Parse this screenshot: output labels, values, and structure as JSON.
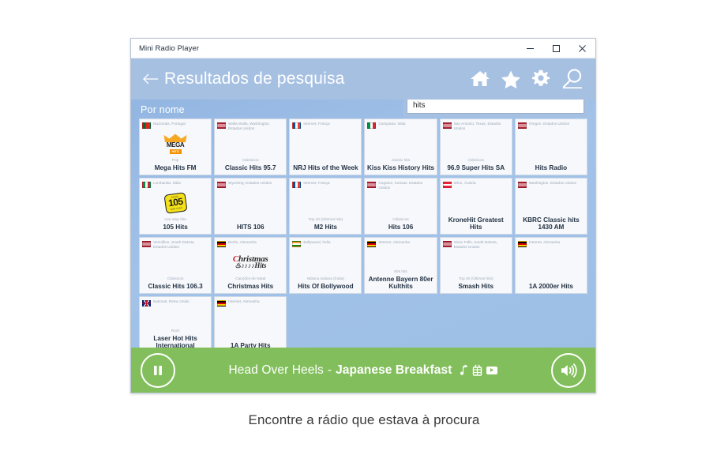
{
  "window": {
    "title": "Mini Radio Player",
    "controls": {
      "minimize": "minimize-icon",
      "maximize": "maximize-icon",
      "close": "close-icon"
    }
  },
  "header": {
    "back": "back-arrow-icon",
    "title": "Resultados de pesquisa",
    "icons": [
      "home-icon",
      "star-icon",
      "gear-icon",
      "search-icon"
    ]
  },
  "search": {
    "value": "hits",
    "placeholder": ""
  },
  "section": {
    "label": "Por nome"
  },
  "colors": {
    "header_blue": "#a6c0e2",
    "body_blue": "#9dbfe6",
    "player_green": "#82bf5c",
    "card_bg": "#f6f8fb",
    "card_border": "#cfd9e6"
  },
  "stations": [
    {
      "flag": "pt",
      "location": "Nacionais, Portugal",
      "genre": "Pop",
      "name": "Mega Hits FM",
      "logo": "mega"
    },
    {
      "flag": "us",
      "location": "Walla Walla, Washington, Estados Unidos",
      "genre": "Clássicos",
      "name": "Classic Hits 95.7",
      "logo": "none"
    },
    {
      "flag": "fr",
      "location": "Internet, França",
      "genre": "",
      "name": "NRJ Hits of the Week",
      "logo": "none"
    },
    {
      "flag": "it",
      "location": "Campania, Itália",
      "genre": "classic hits",
      "name": "Kiss Kiss History Hits",
      "logo": "none"
    },
    {
      "flag": "us",
      "location": "San Antonio, Texas, Estados Unidos",
      "genre": "Clássicos",
      "name": "96.9 Super Hits SA",
      "logo": "none"
    },
    {
      "flag": "us",
      "location": "Oregon, Estados Unidos",
      "genre": "",
      "name": "Hits Radio",
      "logo": "none"
    },
    {
      "flag": "it",
      "location": "Lombardia, Itália",
      "genre": "non-stop hits",
      "name": "105 Hits",
      "logo": "r105"
    },
    {
      "flag": "us",
      "location": "Wyoming, Estados Unidos",
      "genre": "",
      "name": "HITS 106",
      "logo": "none"
    },
    {
      "flag": "fr",
      "location": "Internet, França",
      "genre": "Top 40 (Últimos hits)",
      "name": "M2 Hits",
      "logo": "none"
    },
    {
      "flag": "us",
      "location": "Hugoton, Kansas, Estados Unidos",
      "genre": "Clássicos",
      "name": "Hits 106",
      "logo": "none"
    },
    {
      "flag": "at",
      "location": "Wien, Áustria",
      "genre": "",
      "name": "KroneHit Greatest Hits",
      "logo": "none"
    },
    {
      "flag": "us",
      "location": "Washington, Estados Unidos",
      "genre": "",
      "name": "KBRC Classic hits 1430 AM",
      "logo": "none"
    },
    {
      "flag": "us",
      "location": "Vermillion, South Dakota, Estados Unidos",
      "genre": "Clássicos",
      "name": "Classic Hits 106.3",
      "logo": "none"
    },
    {
      "flag": "de",
      "location": "Berlin, Alemanha",
      "genre": "Canções de Natal",
      "name": "Christmas Hits",
      "logo": "xmas"
    },
    {
      "flag": "in",
      "location": "Bollywood, Índia",
      "genre": "Música indiana (Índia)",
      "name": "Hits Of Bollywood",
      "logo": "none"
    },
    {
      "flag": "de",
      "location": "Internet, Alemanha",
      "genre": "80s hits",
      "name": "Antenne Bayern 80er Kulthits",
      "logo": "none"
    },
    {
      "flag": "us",
      "location": "Sioux Falls, South Dakota, Estados Unidos",
      "genre": "Top 40 (Últimos hits)",
      "name": "Smash Hits",
      "logo": "none"
    },
    {
      "flag": "de",
      "location": "Internet, Alemanha",
      "genre": "",
      "name": "1A 2000er Hits",
      "logo": "none"
    },
    {
      "flag": "gb",
      "location": "National, Reino Unido",
      "genre": "Rock",
      "name": "Laser Hot Hits International",
      "logo": "none"
    },
    {
      "flag": "de",
      "location": "Internet, Alemanha",
      "genre": "",
      "name": "1A Party Hits",
      "logo": "none"
    }
  ],
  "player": {
    "play_pause": "pause-icon",
    "track_title": "Head Over Heels",
    "separator": "-",
    "artist": "Japanese Breakfast",
    "icons": [
      "music-note-icon",
      "store-icon",
      "youtube-icon"
    ],
    "volume": "volume-icon"
  },
  "caption": {
    "text": "Encontre a rádio que estava à procura"
  }
}
